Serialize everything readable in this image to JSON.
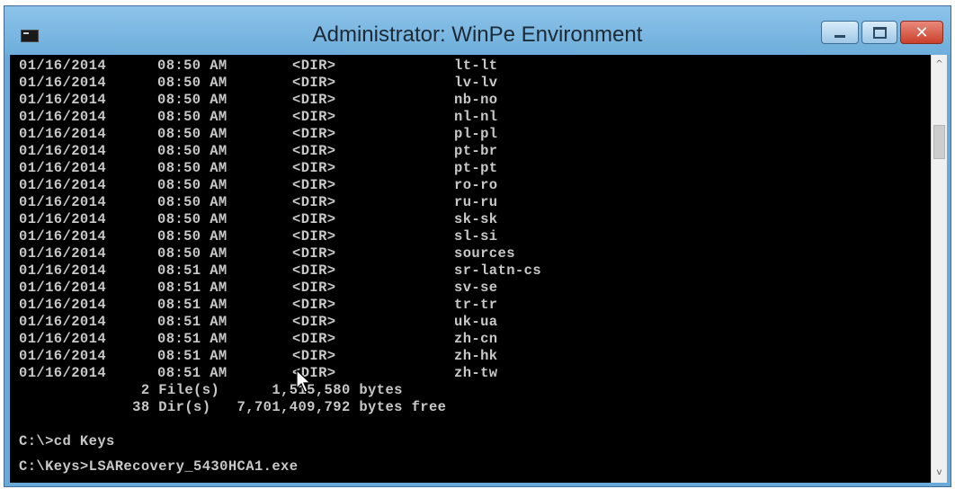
{
  "window": {
    "title": "Administrator: WinPe Environment",
    "icon": "console-icon",
    "controls": {
      "minimize_icon": "minimize-icon",
      "maximize_icon": "maximize-icon",
      "close_icon": "close-icon",
      "close_glyph": "✕"
    }
  },
  "colors": {
    "titlebar": "#6eaedb",
    "console_bg": "#000000",
    "console_text": "#c8c8c8",
    "close_button": "#c9402b"
  },
  "console": {
    "dir_rows": [
      {
        "date": "01/16/2014",
        "time": "08:50 AM",
        "type": "<DIR>",
        "name": "lt-lt"
      },
      {
        "date": "01/16/2014",
        "time": "08:50 AM",
        "type": "<DIR>",
        "name": "lv-lv"
      },
      {
        "date": "01/16/2014",
        "time": "08:50 AM",
        "type": "<DIR>",
        "name": "nb-no"
      },
      {
        "date": "01/16/2014",
        "time": "08:50 AM",
        "type": "<DIR>",
        "name": "nl-nl"
      },
      {
        "date": "01/16/2014",
        "time": "08:50 AM",
        "type": "<DIR>",
        "name": "pl-pl"
      },
      {
        "date": "01/16/2014",
        "time": "08:50 AM",
        "type": "<DIR>",
        "name": "pt-br"
      },
      {
        "date": "01/16/2014",
        "time": "08:50 AM",
        "type": "<DIR>",
        "name": "pt-pt"
      },
      {
        "date": "01/16/2014",
        "time": "08:50 AM",
        "type": "<DIR>",
        "name": "ro-ro"
      },
      {
        "date": "01/16/2014",
        "time": "08:50 AM",
        "type": "<DIR>",
        "name": "ru-ru"
      },
      {
        "date": "01/16/2014",
        "time": "08:50 AM",
        "type": "<DIR>",
        "name": "sk-sk"
      },
      {
        "date": "01/16/2014",
        "time": "08:50 AM",
        "type": "<DIR>",
        "name": "sl-si"
      },
      {
        "date": "01/16/2014",
        "time": "08:50 AM",
        "type": "<DIR>",
        "name": "sources"
      },
      {
        "date": "01/16/2014",
        "time": "08:51 AM",
        "type": "<DIR>",
        "name": "sr-latn-cs"
      },
      {
        "date": "01/16/2014",
        "time": "08:51 AM",
        "type": "<DIR>",
        "name": "sv-se"
      },
      {
        "date": "01/16/2014",
        "time": "08:51 AM",
        "type": "<DIR>",
        "name": "tr-tr"
      },
      {
        "date": "01/16/2014",
        "time": "08:51 AM",
        "type": "<DIR>",
        "name": "uk-ua"
      },
      {
        "date": "01/16/2014",
        "time": "08:51 AM",
        "type": "<DIR>",
        "name": "zh-cn"
      },
      {
        "date": "01/16/2014",
        "time": "08:51 AM",
        "type": "<DIR>",
        "name": "zh-hk"
      },
      {
        "date": "01/16/2014",
        "time": "08:51 AM",
        "type": "<DIR>",
        "name": "zh-tw"
      }
    ],
    "summary_files": "              2 File(s)      1,515,580 bytes",
    "summary_dirs": "             38 Dir(s)   7,701,409,792 bytes free",
    "blank": "",
    "command_cd": "C:\\>cd Keys",
    "prompt_current": "C:\\Keys>LSARecovery_5430HCA1.exe"
  },
  "scrollbar": {
    "up_arrow": "^",
    "down_arrow": "v"
  }
}
